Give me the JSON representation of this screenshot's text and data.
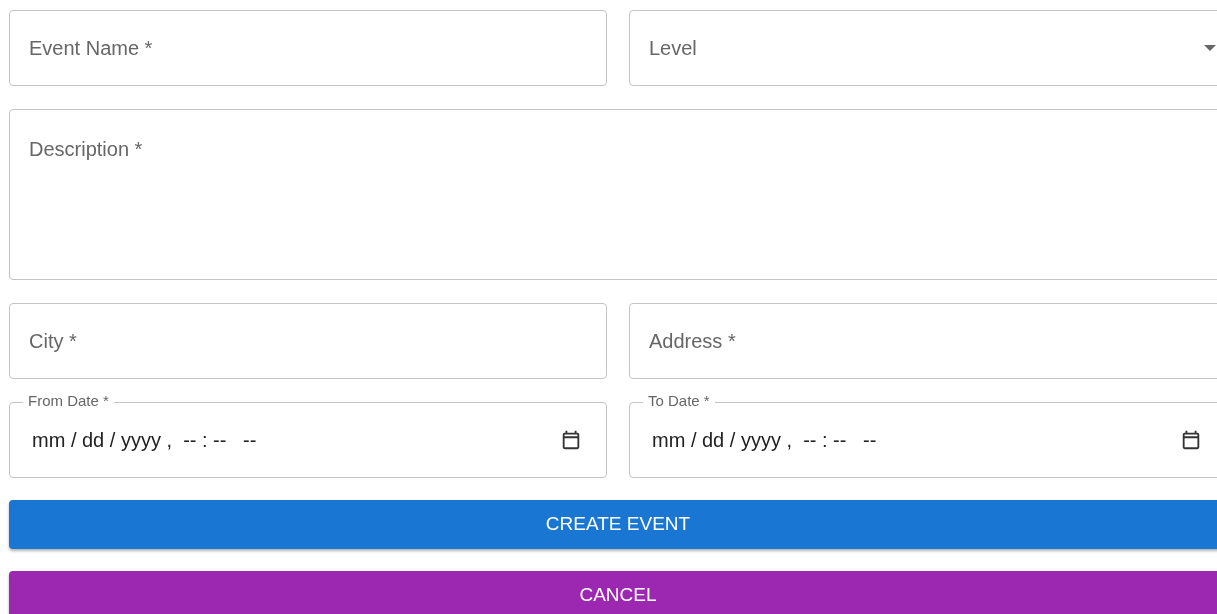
{
  "fields": [
    {
      "kind": "text",
      "label": "Event Name *"
    },
    {
      "kind": "select",
      "label": "Level"
    },
    {
      "kind": "textarea",
      "label": "Description *"
    },
    {
      "kind": "text",
      "label": "City *"
    },
    {
      "kind": "text",
      "label": "Address *"
    },
    {
      "kind": "datetime",
      "label": "From Date *",
      "value": "mm / dd / yyyy ,  -- : --   --"
    },
    {
      "kind": "datetime",
      "label": "To Date *",
      "value": "mm / dd / yyyy ,  -- : --   --"
    }
  ],
  "buttons": [
    {
      "label": "CREATE EVENT",
      "color": "#1976d2"
    },
    {
      "label": "CANCEL",
      "color": "#9c27b0"
    }
  ]
}
